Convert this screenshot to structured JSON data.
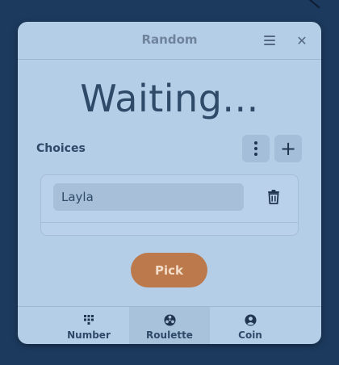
{
  "window": {
    "title": "Random"
  },
  "status": {
    "text": "Waiting..."
  },
  "choices": {
    "label": "Choices",
    "items": [
      {
        "value": "Layla"
      }
    ]
  },
  "actions": {
    "pick_label": "Pick"
  },
  "tabs": [
    {
      "label": "Number",
      "icon": "dice-grid-icon",
      "active": false
    },
    {
      "label": "Roulette",
      "icon": "roulette-icon",
      "active": true
    },
    {
      "label": "Coin",
      "icon": "coin-icon",
      "active": false
    }
  ],
  "colors": {
    "desktop": "#1c3a5e",
    "window_bg": "#b5cee8",
    "accent": "#bc7a4c",
    "text": "#2e4a68"
  }
}
